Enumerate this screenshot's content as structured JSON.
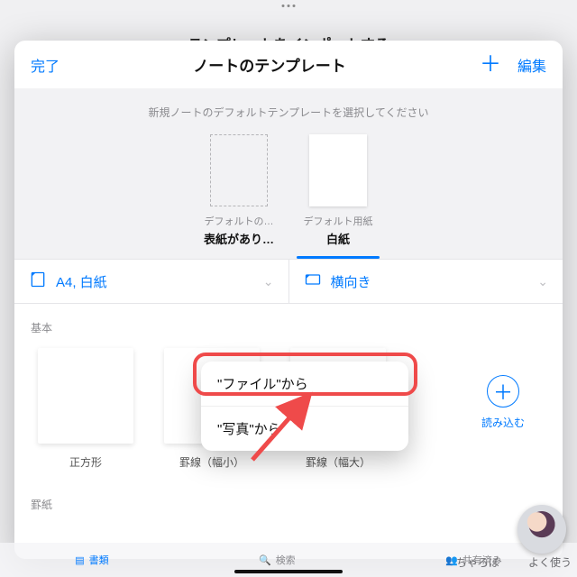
{
  "background": {
    "title_truncated": "テンプレートをインポートする",
    "tabs": {
      "docs": "書類",
      "search": "検索",
      "shared": "共有済み"
    }
  },
  "sheet": {
    "done": "完了",
    "title": "ノートのテンプレート",
    "edit": "編集",
    "default_caption": "新規ノートのデフォルトテンプレートを選択してください",
    "default_items": [
      {
        "sub": "デフォルトの…",
        "main": "表紙があり…",
        "selected": false
      },
      {
        "sub": "デフォルト用紙",
        "main": "白紙",
        "selected": true
      }
    ],
    "selectors": {
      "size": "A4, 白紙",
      "orientation": "横向き"
    },
    "section_basic": "基本",
    "templates": [
      {
        "label": "正方形"
      },
      {
        "label": "罫線（幅小）"
      },
      {
        "label": "罫線（幅大）"
      }
    ],
    "import_label": "読み込む",
    "section_ruled": "罫紙"
  },
  "popover": {
    "from_files": "\"ファイル\"から",
    "from_photos": "\"写真\"から"
  },
  "watermark": {
    "left": "ちゃろぼ",
    "right": "よく使う"
  }
}
